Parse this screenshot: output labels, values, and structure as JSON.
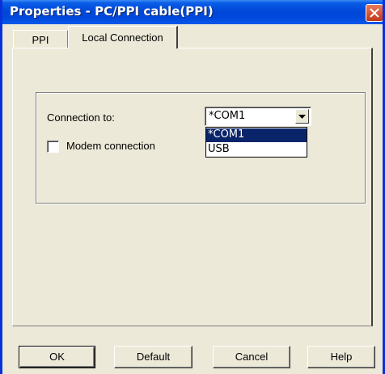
{
  "window": {
    "title": "Properties - PC/PPI cable(PPI)"
  },
  "tabs": [
    {
      "label": "PPI"
    },
    {
      "label": "Local Connection"
    }
  ],
  "connection": {
    "label": "Connection to:",
    "selected": "*COM1",
    "options": [
      "*COM1",
      "USB"
    ]
  },
  "modem": {
    "label": "Modem connection",
    "checked": false
  },
  "buttons": {
    "ok": "OK",
    "default": "Default",
    "cancel": "Cancel",
    "help": "Help"
  }
}
